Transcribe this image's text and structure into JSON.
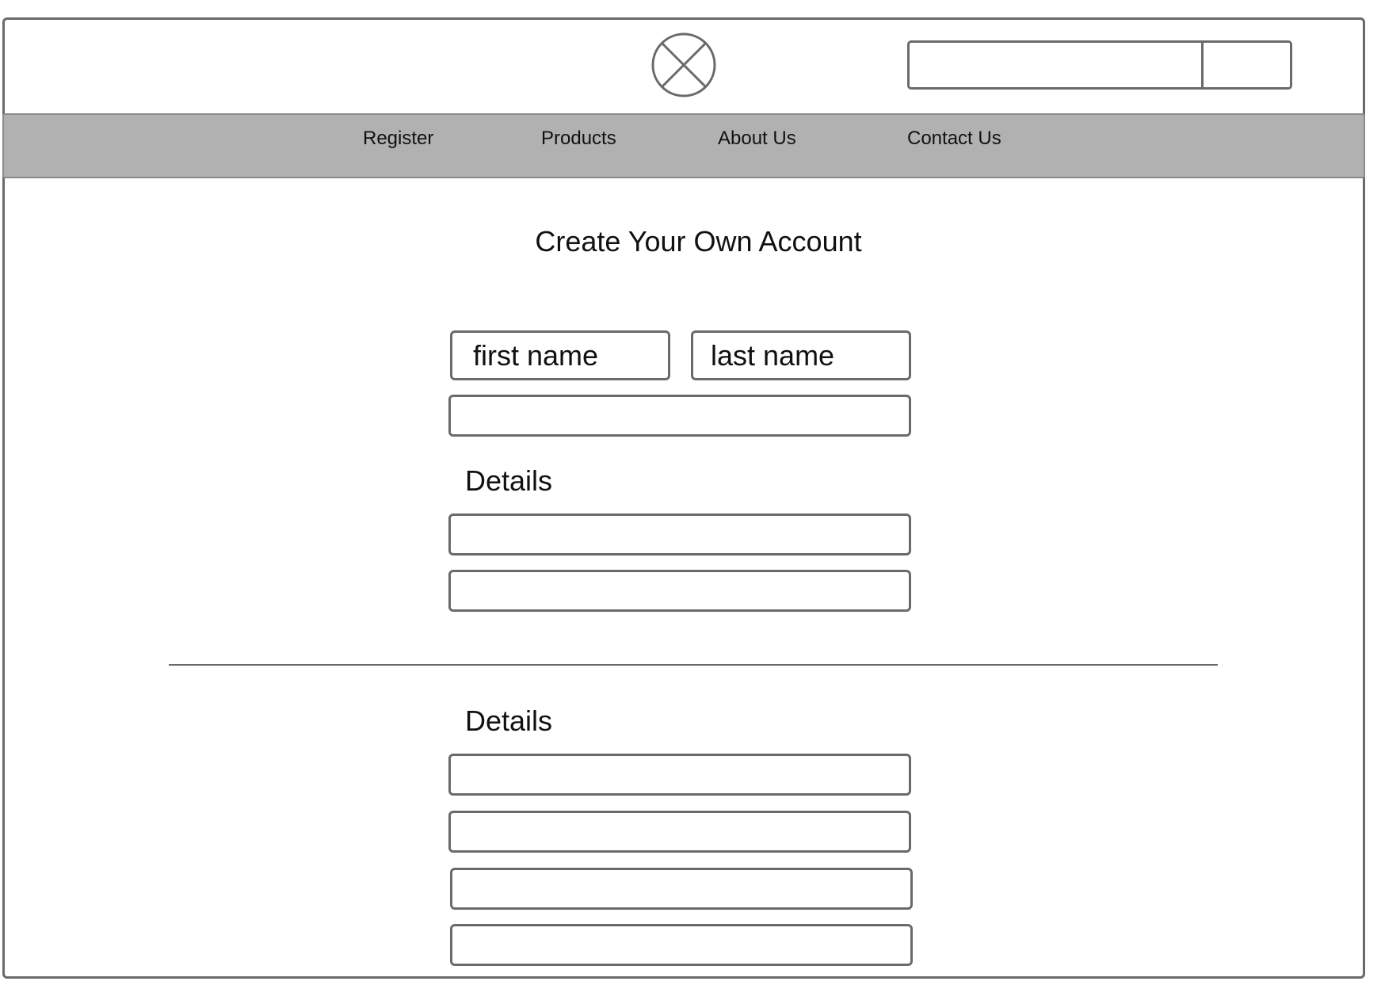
{
  "header": {
    "logo_icon": "image-placeholder-icon",
    "search": {
      "placeholder": "",
      "button_label": ""
    }
  },
  "nav": {
    "items": [
      {
        "label": "Register"
      },
      {
        "label": "Products"
      },
      {
        "label": "About Us"
      },
      {
        "label": "Contact Us"
      }
    ]
  },
  "main": {
    "title": "Create Your Own Account",
    "first_name_placeholder": "first name",
    "last_name_placeholder": "last name",
    "section1_label": "Details",
    "section2_label": "Details"
  },
  "colors": {
    "nav_background": "#b1b1b1",
    "border": "#6a6a6a"
  }
}
